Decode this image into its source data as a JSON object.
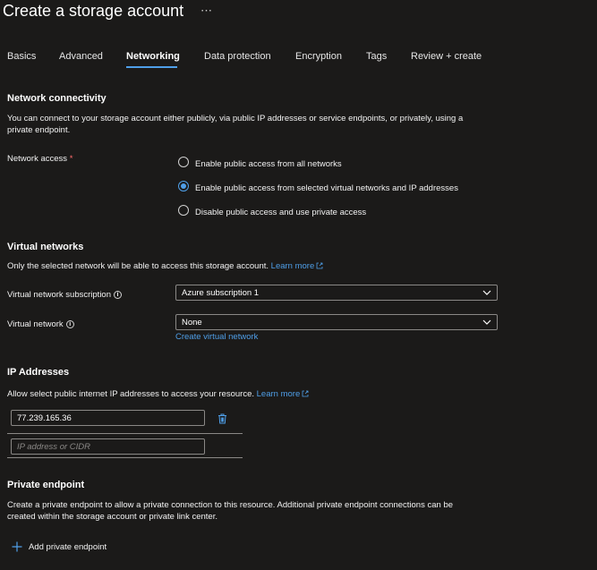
{
  "header": {
    "title": "Create a storage account",
    "more": "⋯"
  },
  "tabs": [
    "Basics",
    "Advanced",
    "Networking",
    "Data protection",
    "Encryption",
    "Tags",
    "Review + create"
  ],
  "network_connectivity": {
    "heading": "Network connectivity",
    "description": "You can connect to your storage account either publicly, via public IP addresses or service endpoints, or privately, using a private endpoint.",
    "access_label": "Network access",
    "required_mark": "*",
    "options": [
      "Enable public access from all networks",
      "Enable public access from selected virtual networks and IP addresses",
      "Disable public access and use private access"
    ],
    "selected_option": "Enable public access from selected virtual networks and IP addresses"
  },
  "virtual_networks": {
    "heading": "Virtual networks",
    "description": "Only the selected network will be able to access this storage account.",
    "learn_more": "Learn more",
    "subscription_label": "Virtual network subscription",
    "subscription_value": "Azure subscription 1",
    "network_label": "Virtual network",
    "network_value": "None",
    "create_link": "Create virtual network"
  },
  "ip_addresses": {
    "heading": "IP Addresses",
    "description": "Allow select public internet IP addresses to access your resource.",
    "learn_more": "Learn more",
    "entries": [
      "77.239.165.36"
    ],
    "placeholder": "IP address or CIDR"
  },
  "private_endpoint": {
    "heading": "Private endpoint",
    "description": "Create a private endpoint to allow a private connection to this resource. Additional private endpoint connections can be created within the storage account or private link center.",
    "add_button": "Add private endpoint"
  },
  "colors": {
    "accent": "#4f9fe8",
    "background": "#1b1a19",
    "required": "#ff6b6b"
  }
}
